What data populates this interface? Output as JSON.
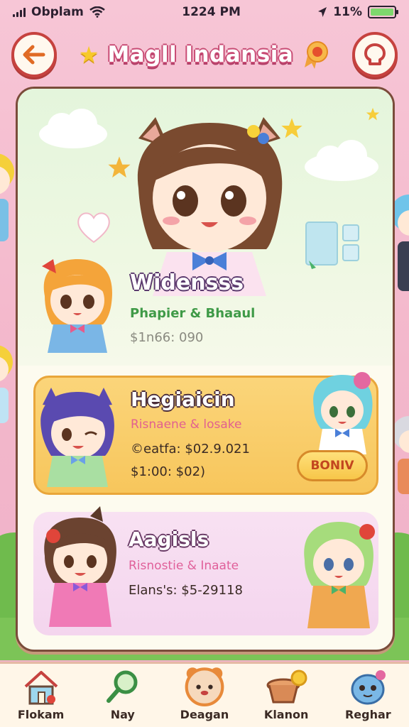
{
  "status": {
    "carrier": "Obplam",
    "time": "1224 PM",
    "battery_pct": "11%"
  },
  "header": {
    "title": "Magll Indansia",
    "back_icon": "arrow-left-icon",
    "menu_icon": "badge-icon"
  },
  "hero": {
    "name": "Widensss",
    "subtitle": "Phapier & Bhaaul",
    "price": "$1n66: 090"
  },
  "cards": [
    {
      "title": "Hegiaicin",
      "subtitle": "Risnaene & losake",
      "line1": "©eatfa: $02.9.021",
      "line2": "$1:00: $02)",
      "button": "BONIV"
    },
    {
      "title": "Aagisls",
      "subtitle": "Risnostie & Inaate",
      "line1": "Elans's: $5-29118"
    }
  ],
  "nav": [
    {
      "label": "Flokam",
      "icon": "house-icon"
    },
    {
      "label": "Nay",
      "icon": "magnifier-icon"
    },
    {
      "label": "Deagan",
      "icon": "bear-icon"
    },
    {
      "label": "Klanon",
      "icon": "basket-icon"
    },
    {
      "label": "Reghar",
      "icon": "monster-icon"
    }
  ],
  "colors": {
    "background": "#f3b7cb",
    "panel": "#fdfbef",
    "accent_red": "#c6423f",
    "orange_card": "#f7c65c",
    "pink_card": "#f4d5ee"
  }
}
